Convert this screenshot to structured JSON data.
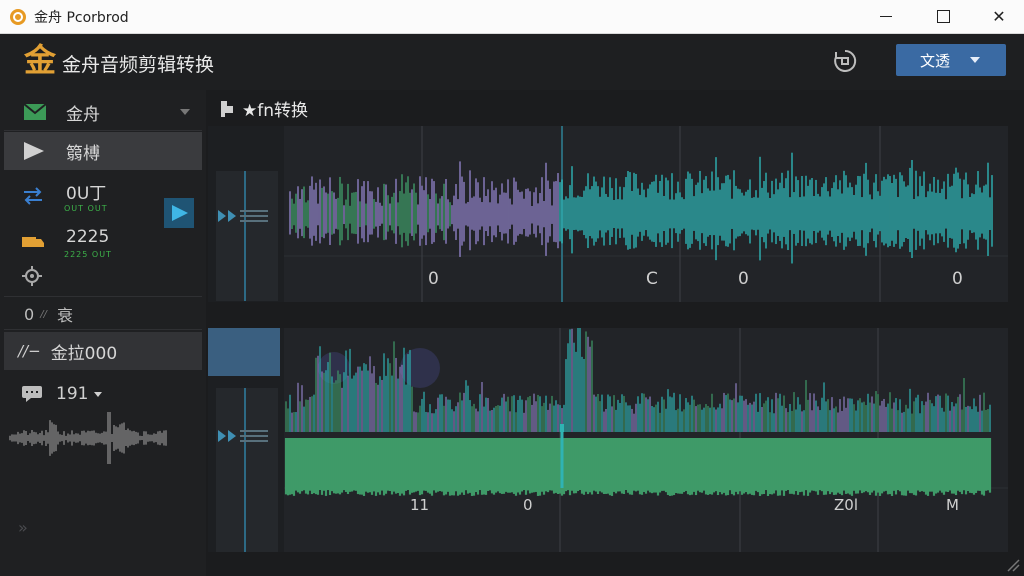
{
  "window": {
    "title": "金舟 Pcorbrod"
  },
  "header": {
    "logo_char": "金",
    "app_title": "金舟音频剪辑转换",
    "action_label": "文透"
  },
  "sidebar": {
    "top_label": "金舟",
    "selected_label": "篛榑",
    "item_out_label": "0U丁",
    "item_out_sub": "OUT OUT",
    "item_num_label": "2225",
    "item_num_sub": "2225 OUT",
    "small_label": "0",
    "small_suffix": "衰",
    "group_label": "金拉000",
    "group_prefix": "//−",
    "counter_label": "191"
  },
  "main": {
    "title": "★fn转换",
    "track1_labels": [
      "0",
      "C",
      "0",
      "0"
    ],
    "track2_labels": [
      "11",
      "0",
      "Z0l",
      "M"
    ]
  },
  "colors": {
    "accent_gold": "#e2a034",
    "button_blue": "#3a6aa3",
    "wave_cyan": "#2fb3b3",
    "wave_purple": "#8d7fc2",
    "wave_green": "#3f9a68"
  }
}
